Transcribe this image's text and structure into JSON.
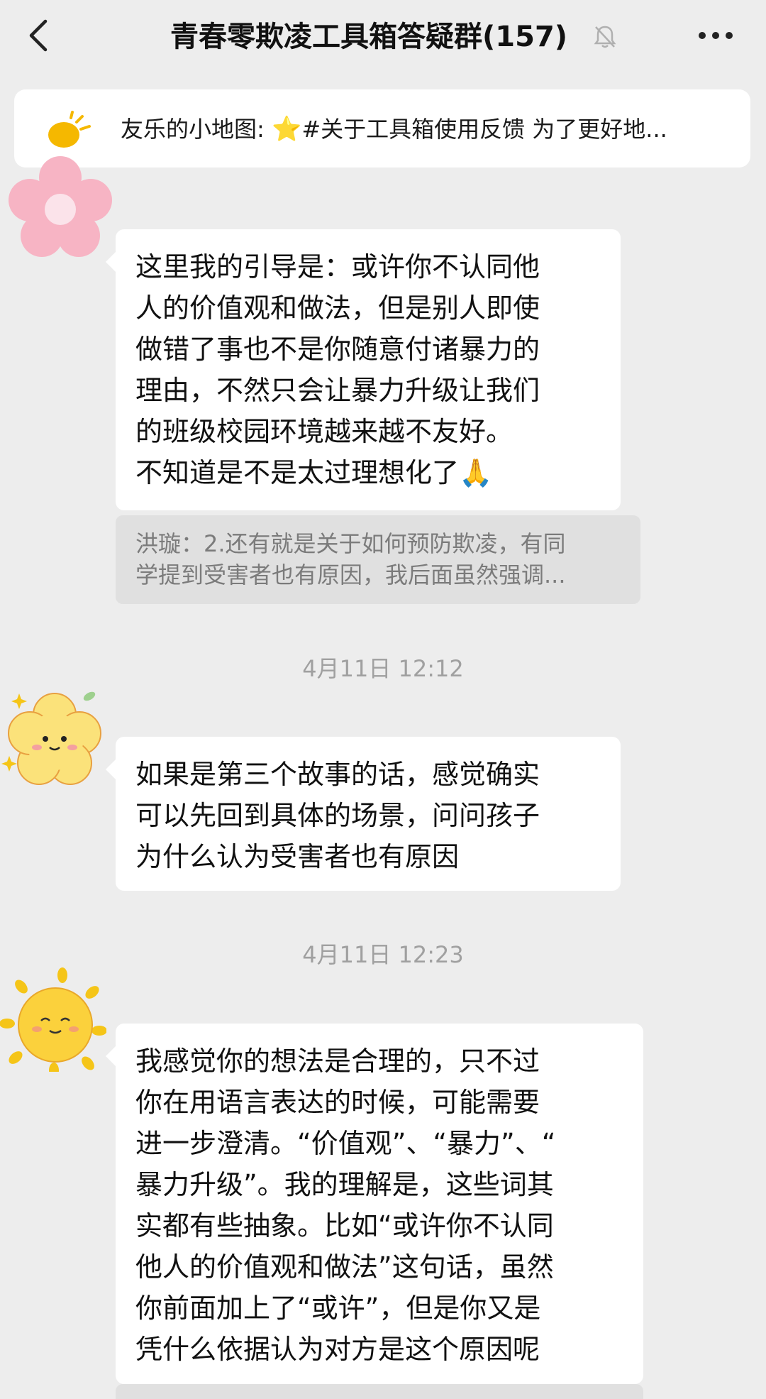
{
  "header": {
    "back_icon": "chevron-left-icon",
    "title": "青春零欺凌工具箱答疑群(157)",
    "mute_icon": "bell-muted-icon",
    "more_icon": "more-dots-icon"
  },
  "pinned": {
    "icon": "announcement-icon",
    "sender": "友乐的小地图:",
    "star": "⭐",
    "text": "#关于工具箱使用反馈  为了更好地..."
  },
  "messages": [
    {
      "avatar": "pink-flower-avatar",
      "lines": [
        "这里我的引导是：或许你不认同他",
        "人的价值观和做法，但是别人即使",
        "做错了事也不是你随意付诸暴力的",
        "理由，不然只会让暴力升级让我们",
        "的班级校园环境越来越不友好。",
        "不知道是不是太过理想化了"
      ],
      "emoji": "🙏",
      "quote_lines": [
        "洪璇：2.还有就是关于如何预防欺凌，有同",
        "学提到受害者也有原因，我后面虽然强调..."
      ]
    },
    {
      "timestamp": "4月11日 12:12",
      "avatar": "yellow-flower-avatar",
      "lines": [
        "如果是第三个故事的话，感觉确实",
        "可以先回到具体的场景，问问孩子",
        "为什么认为受害者也有原因"
      ]
    },
    {
      "timestamp": "4月11日 12:23",
      "avatar": "sun-avatar",
      "lines": [
        "我感觉你的想法是合理的，只不过",
        "你在用语言表达的时候，可能需要",
        "进一步澄清。“价值观”、“暴力”、“",
        "暴力升级”。我的理解是，这些词其",
        "实都有些抽象。比如“或许你不认同",
        "他人的价值观和做法”这句话，虽然",
        "你前面加上了“或许”，但是你又是",
        "凭什么依据认为对方是这个原因呢"
      ]
    }
  ]
}
